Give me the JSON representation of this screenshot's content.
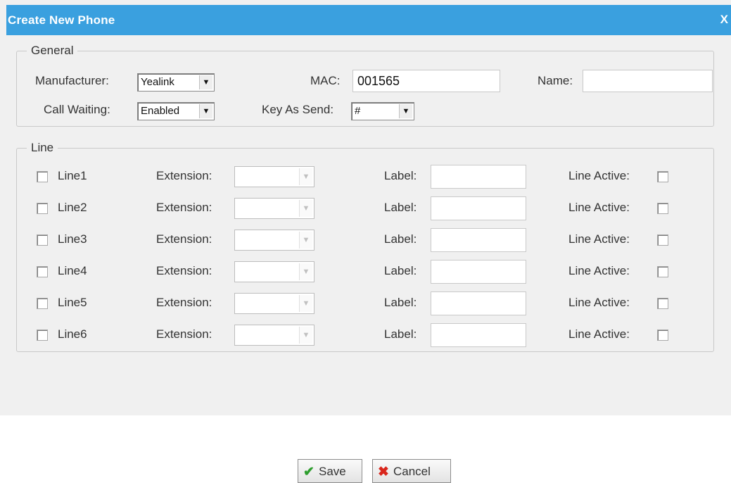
{
  "dialog": {
    "title": "Create New Phone",
    "close_label": "X"
  },
  "general": {
    "legend": "General",
    "manufacturer_label": "Manufacturer:",
    "manufacturer_value": "Yealink",
    "mac_label": "MAC:",
    "mac_value": "001565",
    "name_label": "Name:",
    "name_value": "",
    "call_waiting_label": "Call Waiting:",
    "call_waiting_value": "Enabled",
    "key_as_send_label": "Key As Send:",
    "key_as_send_value": "#"
  },
  "line": {
    "legend": "Line",
    "extension_label": "Extension:",
    "label_label": "Label:",
    "line_active_label": "Line Active:",
    "rows": [
      {
        "name": "Line1",
        "extension": "",
        "label": "",
        "checked": false,
        "active": false
      },
      {
        "name": "Line2",
        "extension": "",
        "label": "",
        "checked": false,
        "active": false
      },
      {
        "name": "Line3",
        "extension": "",
        "label": "",
        "checked": false,
        "active": false
      },
      {
        "name": "Line4",
        "extension": "",
        "label": "",
        "checked": false,
        "active": false
      },
      {
        "name": "Line5",
        "extension": "",
        "label": "",
        "checked": false,
        "active": false
      },
      {
        "name": "Line6",
        "extension": "",
        "label": "",
        "checked": false,
        "active": false
      }
    ]
  },
  "buttons": {
    "save_label": "Save",
    "cancel_label": "Cancel"
  },
  "icons": {
    "save": "check-icon",
    "cancel": "x-icon",
    "dropdown": "chevron-down-icon"
  },
  "colors": {
    "titlebar": "#3aa0df",
    "save_icon": "#2e9e2e",
    "cancel_icon": "#d9261c"
  }
}
